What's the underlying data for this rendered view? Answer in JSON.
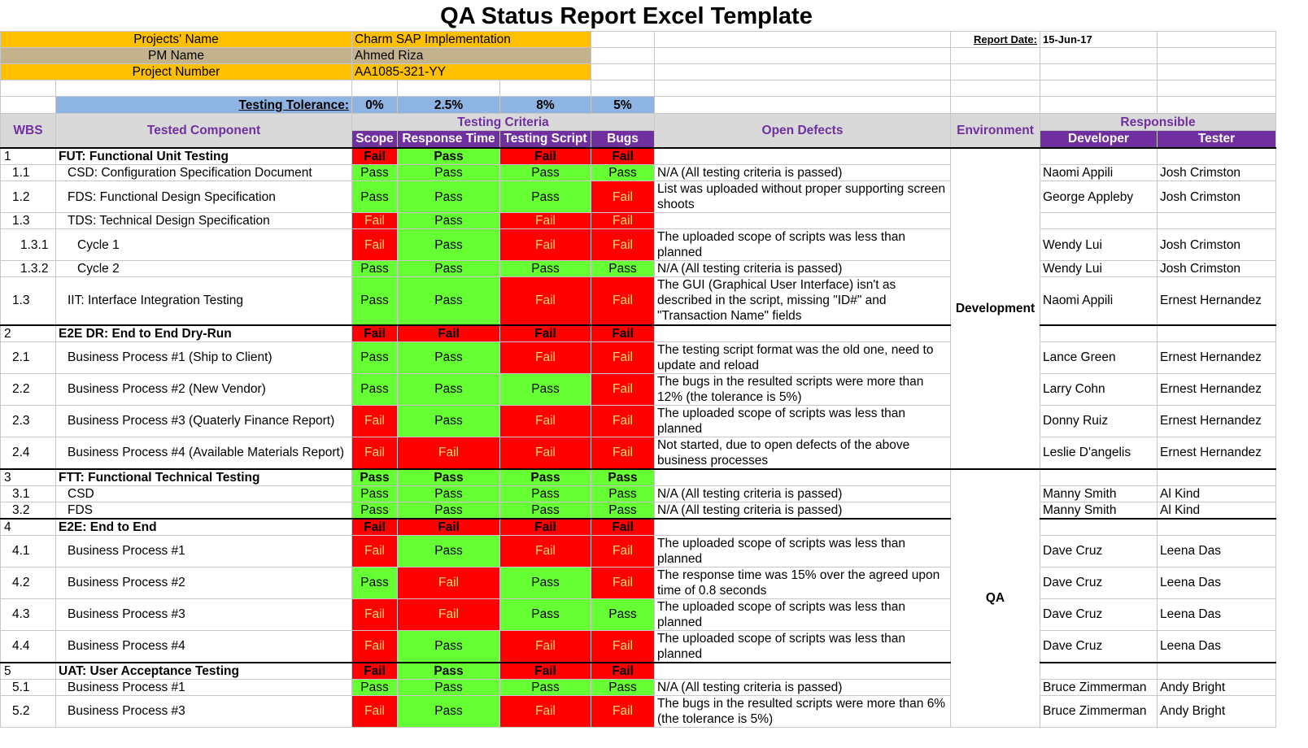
{
  "title": "QA Status Report Excel Template",
  "info": {
    "projects_name_label": "Projects' Name",
    "projects_name_value": "Charm SAP Implementation",
    "pm_name_label": "PM Name",
    "pm_name_value": "Ahmed Riza",
    "project_number_label": "Project Number",
    "project_number_value": "AA1085-321-YY",
    "report_date_label": "Report Date:",
    "report_date_value": "15-Jun-17"
  },
  "tolerance": {
    "label": "Testing Tolerance:",
    "scope": "0%",
    "response_time": "2.5%",
    "testing_script": "8%",
    "bugs": "5%"
  },
  "headers": {
    "wbs": "WBS",
    "component": "Tested Component",
    "criteria": "Testing Criteria",
    "scope": "Scope",
    "response_time": "Response Time",
    "testing_script": "Testing Script",
    "bugs": "Bugs",
    "open_defects": "Open Defects",
    "environment": "Environment",
    "responsible": "Responsible",
    "developer": "Developer",
    "tester": "Tester"
  },
  "environments": {
    "development": "Development",
    "qa": "QA"
  },
  "rows": [
    {
      "wbs": "1",
      "component": "FUT: Functional Unit Testing",
      "scope": "Fail",
      "response": "Pass",
      "script": "Fail",
      "bugs": "Fail",
      "defect": "",
      "developer": "",
      "tester": ""
    },
    {
      "wbs": "1.1",
      "component": "CSD: Configuration Specification Document",
      "scope": "Pass",
      "response": "Pass",
      "script": "Pass",
      "bugs": "Pass",
      "defect": "N/A (All testing criteria is passed)",
      "developer": "Naomi Appili",
      "tester": "Josh Crimston"
    },
    {
      "wbs": "1.2",
      "component": "FDS: Functional Design Specification",
      "scope": "Pass",
      "response": "Pass",
      "script": "Pass",
      "bugs": "Fail",
      "defect": "List was uploaded without proper supporting screen shoots",
      "developer": "George Appleby",
      "tester": "Josh Crimston"
    },
    {
      "wbs": "1.3",
      "component": "TDS: Technical Design Specification",
      "scope": "Fail",
      "response": "Pass",
      "script": "Fail",
      "bugs": "Fail",
      "defect": "",
      "developer": "",
      "tester": ""
    },
    {
      "wbs": "1.3.1",
      "component": "Cycle 1",
      "scope": "Fail",
      "response": "Pass",
      "script": "Fail",
      "bugs": "Fail",
      "defect": "The uploaded scope of scripts was less than planned",
      "developer": "Wendy Lui",
      "tester": "Josh Crimston"
    },
    {
      "wbs": "1.3.2",
      "component": "Cycle 2",
      "scope": "Pass",
      "response": "Pass",
      "script": "Pass",
      "bugs": "Pass",
      "defect": "N/A (All testing criteria is passed)",
      "developer": "Wendy Lui",
      "tester": "Josh Crimston"
    },
    {
      "wbs": "1.3",
      "component": "IIT: Interface Integration Testing",
      "scope": "Pass",
      "response": "Pass",
      "script": "Fail",
      "bugs": "Fail",
      "defect": "The GUI (Graphical User Interface) isn't as described in the script, missing \"ID#\" and \"Transaction Name\" fields",
      "developer": "Naomi Appili",
      "tester": "Ernest Hernandez"
    },
    {
      "wbs": "2",
      "component": "E2E DR: End to End Dry-Run",
      "scope": "Fail",
      "response": "Fail",
      "script": "Fail",
      "bugs": "Fail",
      "defect": "",
      "developer": "",
      "tester": ""
    },
    {
      "wbs": "2.1",
      "component": "Business Process #1 (Ship to Client)",
      "scope": "Pass",
      "response": "Pass",
      "script": "Fail",
      "bugs": "Fail",
      "defect": "The testing script format was the old one, need to update and reload",
      "developer": "Lance Green",
      "tester": "Ernest Hernandez"
    },
    {
      "wbs": "2.2",
      "component": "Business Process #2 (New Vendor)",
      "scope": "Pass",
      "response": "Pass",
      "script": "Pass",
      "bugs": "Fail",
      "defect": "The bugs in the resulted scripts were more than 12% (the tolerance is 5%)",
      "developer": "Larry Cohn",
      "tester": "Ernest Hernandez"
    },
    {
      "wbs": "2.3",
      "component": "Business Process #3 (Quaterly Finance Report)",
      "scope": "Fail",
      "response": "Pass",
      "script": "Fail",
      "bugs": "Fail",
      "defect": "The uploaded scope of scripts was less than planned",
      "developer": "Donny Ruiz",
      "tester": "Ernest Hernandez"
    },
    {
      "wbs": "2.4",
      "component": "Business Process #4 (Available Materials Report)",
      "scope": "Fail",
      "response": "Fail",
      "script": "Fail",
      "bugs": "Fail",
      "defect": "Not started, due to open defects of the above business processes",
      "developer": "Leslie D'angelis",
      "tester": "Ernest Hernandez"
    },
    {
      "wbs": "3",
      "component": "FTT: Functional Technical Testing",
      "scope": "Pass",
      "response": "Pass",
      "script": "Pass",
      "bugs": "Pass",
      "defect": "",
      "developer": "",
      "tester": ""
    },
    {
      "wbs": "3.1",
      "component": "CSD",
      "scope": "Pass",
      "response": "Pass",
      "script": "Pass",
      "bugs": "Pass",
      "defect": "N/A (All testing criteria is passed)",
      "developer": "Manny Smith",
      "tester": "Al Kind"
    },
    {
      "wbs": "3.2",
      "component": "FDS",
      "scope": "Pass",
      "response": "Pass",
      "script": "Pass",
      "bugs": "Pass",
      "defect": "N/A (All testing criteria is passed)",
      "developer": "Manny Smith",
      "tester": "Al Kind"
    },
    {
      "wbs": "4",
      "component": "E2E: End to End",
      "scope": "Fail",
      "response": "Fail",
      "script": "Fail",
      "bugs": "Fail",
      "defect": "",
      "developer": "",
      "tester": ""
    },
    {
      "wbs": "4.1",
      "component": "Business Process #1",
      "scope": "Fail",
      "response": "Pass",
      "script": "Fail",
      "bugs": "Fail",
      "defect": "The uploaded scope of scripts was less than planned",
      "developer": "Dave Cruz",
      "tester": "Leena Das"
    },
    {
      "wbs": "4.2",
      "component": "Business Process #2",
      "scope": "Pass",
      "response": "Fail",
      "script": "Pass",
      "bugs": "Fail",
      "defect": "The response time was 15% over the agreed upon time of 0.8 seconds",
      "developer": "Dave Cruz",
      "tester": "Leena Das"
    },
    {
      "wbs": "4.3",
      "component": "Business Process #3",
      "scope": "Fail",
      "response": "Fail",
      "script": "Pass",
      "bugs": "Pass",
      "defect": "The uploaded scope of scripts was less than planned",
      "developer": "Dave Cruz",
      "tester": "Leena Das"
    },
    {
      "wbs": "4.4",
      "component": "Business Process #4",
      "scope": "Fail",
      "response": "Pass",
      "script": "Fail",
      "bugs": "Fail",
      "defect": "The uploaded scope of scripts was less than planned",
      "developer": "Dave Cruz",
      "tester": "Leena Das"
    },
    {
      "wbs": "5",
      "component": "UAT: User Acceptance Testing",
      "scope": "Fail",
      "response": "Pass",
      "script": "Fail",
      "bugs": "Fail",
      "defect": "",
      "developer": "",
      "tester": ""
    },
    {
      "wbs": "5.1",
      "component": "Business Process #1",
      "scope": "Pass",
      "response": "Pass",
      "script": "Pass",
      "bugs": "Pass",
      "defect": "N/A (All testing criteria is passed)",
      "developer": "Bruce Zimmerman",
      "tester": "Andy Bright"
    },
    {
      "wbs": "5.2",
      "component": "Business Process #3",
      "scope": "Fail",
      "response": "Pass",
      "script": "Fail",
      "bugs": "Fail",
      "defect": "The bugs in the resulted scripts were more than 6% (the tolerance is 5%)",
      "developer": "Bruce Zimmerman",
      "tester": "Andy Bright"
    }
  ]
}
